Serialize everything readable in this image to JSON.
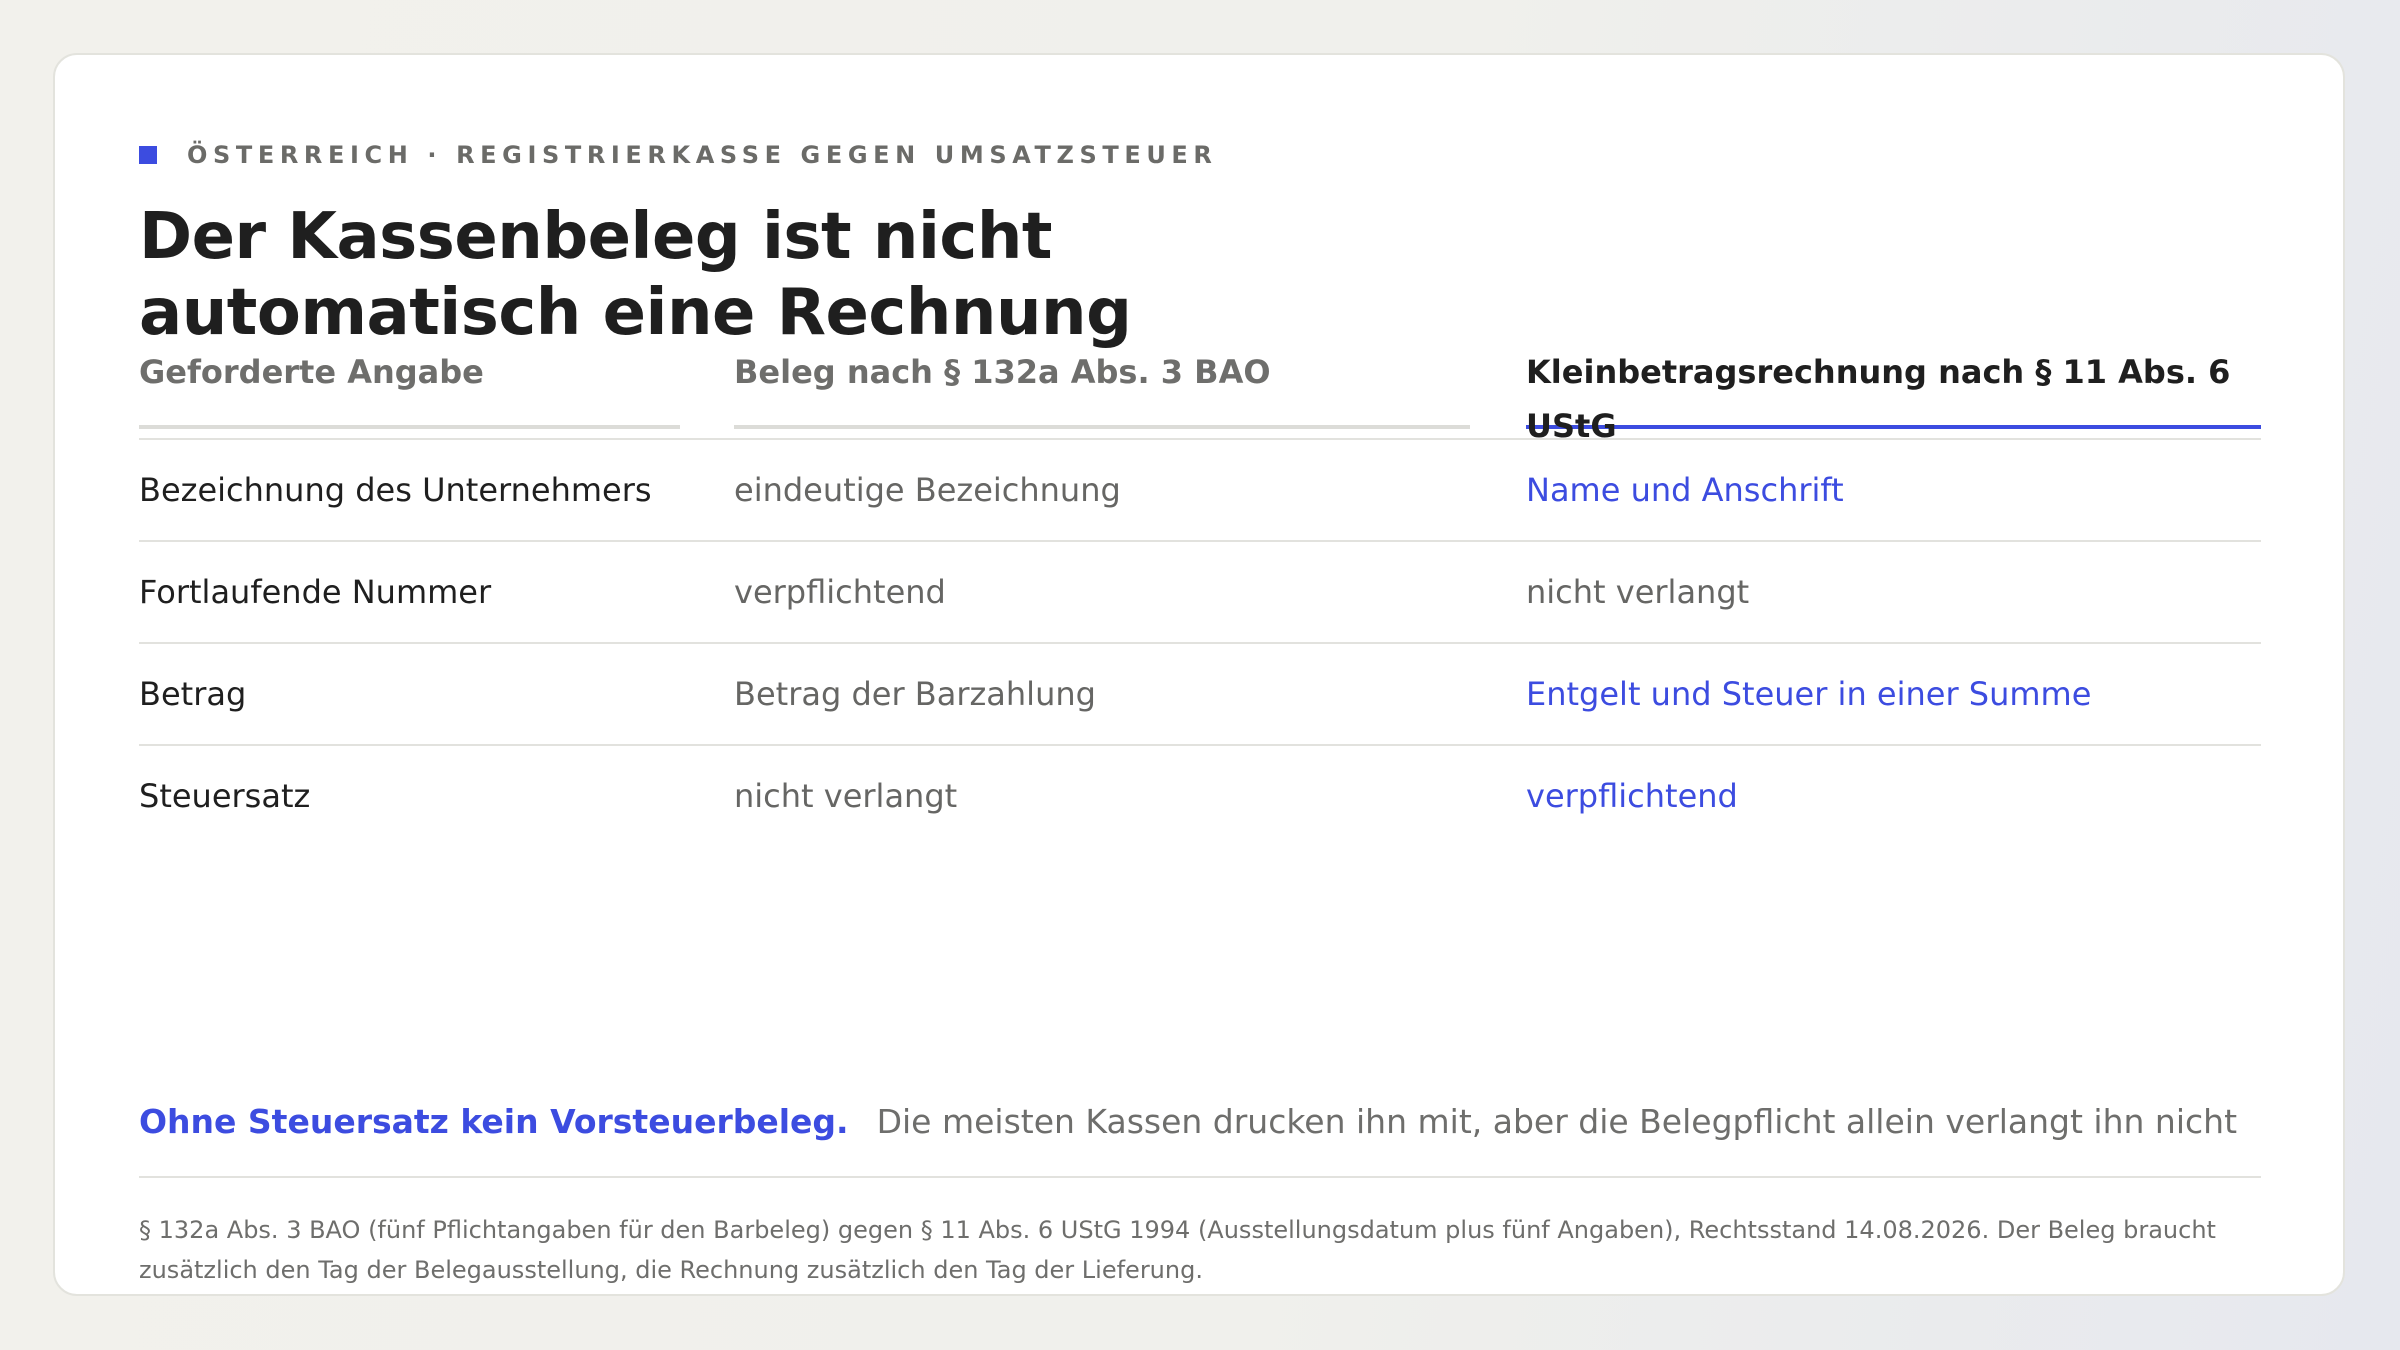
{
  "eyebrow": {
    "accent_color": "#3c4ce0",
    "text": "ÖSTERREICH · REGISTRIERKASSE GEGEN UMSATZSTEUER"
  },
  "title": "Der Kassenbeleg ist nicht automatisch eine Rechnung",
  "table": {
    "headers": [
      "Geforderte Angabe",
      "Beleg nach § 132a Abs. 3 BAO",
      "Kleinbetragsrechnung nach § 11 Abs. 6 UStG"
    ],
    "rows": [
      [
        "Bezeichnung des Unternehmers",
        "eindeutige Bezeichnung",
        "Name und Anschrift"
      ],
      [
        "Fortlaufende Nummer",
        "verpflichtend",
        "nicht verlangt"
      ],
      [
        "Betrag",
        "Betrag der Barzahlung",
        "Entgelt und Steuer in einer Summe"
      ],
      [
        "Steuersatz",
        "nicht verlangt",
        "verpflichtend"
      ]
    ]
  },
  "callout": {
    "strong": "Ohne Steuersatz kein Vorsteuerbeleg.",
    "text": "Die meisten Kassen drucken ihn mit, aber die Belegpflicht allein verlangt ihn nicht"
  },
  "footnote": "§ 132a Abs. 3 BAO (fünf Pflichtangaben für den Barbeleg) gegen § 11 Abs. 6 UStG 1994 (Ausstellungsdatum plus fünf Angaben), Rechtsstand 14.08.2026. Der Beleg braucht zusätzlich den Tag der Belegausstellung, die Rechnung zusätzlich den Tag der Lieferung."
}
